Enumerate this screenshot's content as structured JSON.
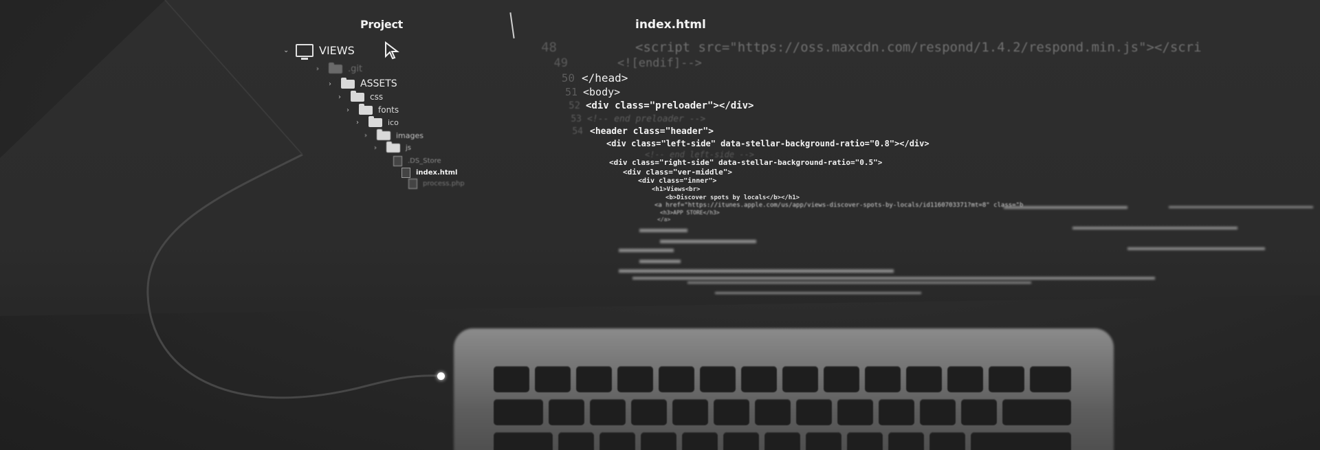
{
  "sidebar": {
    "title": "Project",
    "items": [
      {
        "label": "VIEWS",
        "kind": "monitor",
        "chevron": "chevron-down"
      },
      {
        "label": ".git",
        "kind": "folder-dim",
        "chevron": "chevron-right"
      },
      {
        "label": "ASSETS",
        "kind": "folder",
        "chevron": "chevron-down"
      },
      {
        "label": "css",
        "kind": "folder",
        "chevron": "chevron-right"
      },
      {
        "label": "fonts",
        "kind": "folder",
        "chevron": "chevron-right"
      },
      {
        "label": "ico",
        "kind": "folder",
        "chevron": "chevron-right"
      },
      {
        "label": "images",
        "kind": "folder",
        "chevron": "chevron-right"
      },
      {
        "label": "js",
        "kind": "folder",
        "chevron": "chevron-right"
      },
      {
        "label": ".DS_Store",
        "kind": "file",
        "chevron": ""
      },
      {
        "label": "index.html",
        "kind": "file",
        "chevron": ""
      },
      {
        "label": "process.php",
        "kind": "file",
        "chevron": ""
      }
    ]
  },
  "editor": {
    "tab_title": "index.html",
    "lines": [
      {
        "num": "48",
        "text": "<script src=\"https://oss.maxcdn.com/respond/1.4.2/respond.min.js\"></scri"
      },
      {
        "num": "49",
        "text": "<![endif]-->"
      },
      {
        "num": "50",
        "text": "</head>"
      },
      {
        "num": "51",
        "text": "<body>"
      },
      {
        "num": "52",
        "text": "<div class=\"preloader\"></div>"
      },
      {
        "num": "53",
        "text": "<!-- end preloader -->"
      },
      {
        "num": "54",
        "text": "<header class=\"header\">"
      },
      {
        "num": "",
        "text": "<div class=\"left-side\" data-stellar-background-ratio=\"0.8\"></div>"
      },
      {
        "num": "",
        "text": "<!-- end left-side -->"
      },
      {
        "num": "",
        "text": "<div class=\"right-side\" data-stellar-background-ratio=\"0.5\">"
      },
      {
        "num": "",
        "text": "<div class=\"ver-middle\">"
      },
      {
        "num": "",
        "text": "<div class=\"inner\">"
      },
      {
        "num": "",
        "text": "<h1>Views<br>"
      },
      {
        "num": "",
        "text": "<b>Discover spots by locals</b></h1>"
      },
      {
        "num": "",
        "text": "<a href=\"https://itunes.apple.com/us/app/views-discover-spots-by-locals/id1160703371?mt=8\" class=\"b"
      },
      {
        "num": "",
        "text": "<h3>APP STORE</h3>"
      },
      {
        "num": "",
        "text": "</a>"
      }
    ]
  },
  "colors": {
    "background": "#2b2b2b",
    "text": "#e8e8e8",
    "comment": "#6b6b6b"
  }
}
